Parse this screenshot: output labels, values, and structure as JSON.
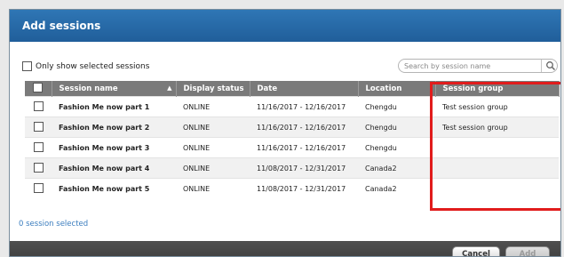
{
  "dialog": {
    "title": "Add sessions"
  },
  "toolbar": {
    "only_show_label": "Only show selected sessions",
    "search_placeholder": "Search by session name"
  },
  "table": {
    "headers": [
      "Session name",
      "Display status",
      "Date",
      "Location",
      "Session group"
    ],
    "rows": [
      {
        "name": "Fashion Me now part 1",
        "status": "ONLINE",
        "date": "11/16/2017 - 12/16/2017",
        "location": "Chengdu",
        "group": "Test session group"
      },
      {
        "name": "Fashion Me now part 2",
        "status": "ONLINE",
        "date": "11/16/2017 - 12/16/2017",
        "location": "Chengdu",
        "group": "Test session group"
      },
      {
        "name": "Fashion Me now part 3",
        "status": "ONLINE",
        "date": "11/16/2017 - 12/16/2017",
        "location": "Chengdu",
        "group": ""
      },
      {
        "name": "Fashion Me now part 4",
        "status": "ONLINE",
        "date": "11/08/2017 - 12/31/2017",
        "location": "Canada2",
        "group": ""
      },
      {
        "name": "Fashion Me now part 5",
        "status": "ONLINE",
        "date": "11/08/2017 - 12/31/2017",
        "location": "Canada2",
        "group": ""
      }
    ]
  },
  "status": {
    "selected_text": "0 session selected"
  },
  "footer": {
    "cancel_label": "Cancel",
    "add_label": "Add"
  },
  "colors": {
    "title_bar": "#2f76b5",
    "header_bg": "#7a7a7a",
    "highlight": "#e11c1c",
    "link": "#3c7ebf"
  }
}
